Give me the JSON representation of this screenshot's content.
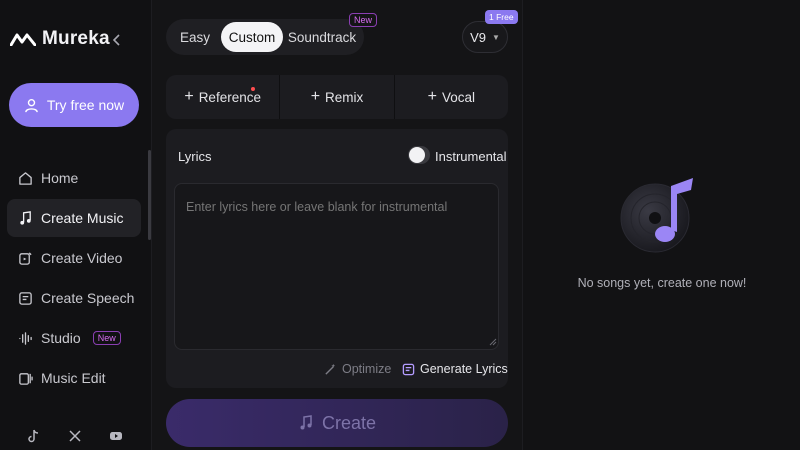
{
  "app": {
    "name": "Mureka",
    "collapse_icon": "chevron-left-icon"
  },
  "sidebar": {
    "try_button": {
      "label": "Try free now",
      "icon": "user-icon"
    },
    "items": [
      {
        "label": "Home",
        "icon": "home-icon",
        "active": false
      },
      {
        "label": "Create Music",
        "icon": "music-note-icon",
        "active": true
      },
      {
        "label": "Create Video",
        "icon": "video-edit-icon",
        "active": false
      },
      {
        "label": "Create Speech",
        "icon": "speech-icon",
        "active": false
      },
      {
        "label": "Studio",
        "icon": "waveform-icon",
        "active": false,
        "badge": "New"
      },
      {
        "label": "Music Edit",
        "icon": "music-edit-icon",
        "active": false
      }
    ],
    "socials": [
      "tiktok-icon",
      "x-icon",
      "youtube-icon"
    ]
  },
  "main": {
    "mode_tabs": [
      {
        "label": "Easy"
      },
      {
        "label": "Custom",
        "selected": true
      },
      {
        "label": "Soundtrack",
        "badge": "New"
      }
    ],
    "version": {
      "label": "V9",
      "badge": "1 Free"
    },
    "options": [
      {
        "label": "Reference",
        "has_dot": true
      },
      {
        "label": "Remix"
      },
      {
        "label": "Vocal"
      }
    ],
    "lyrics": {
      "label": "Lyrics",
      "instrumental_label": "Instrumental",
      "instrumental_on": false,
      "placeholder": "Enter lyrics here or leave blank for instrumental",
      "optimize_label": "Optimize",
      "generate_label": "Generate Lyrics"
    },
    "create_label": "Create"
  },
  "right": {
    "empty_text": "No songs yet, create one now!"
  },
  "colors": {
    "accent": "#8b79f0",
    "badge": "#d66cf0",
    "background": "#0e0e10"
  }
}
